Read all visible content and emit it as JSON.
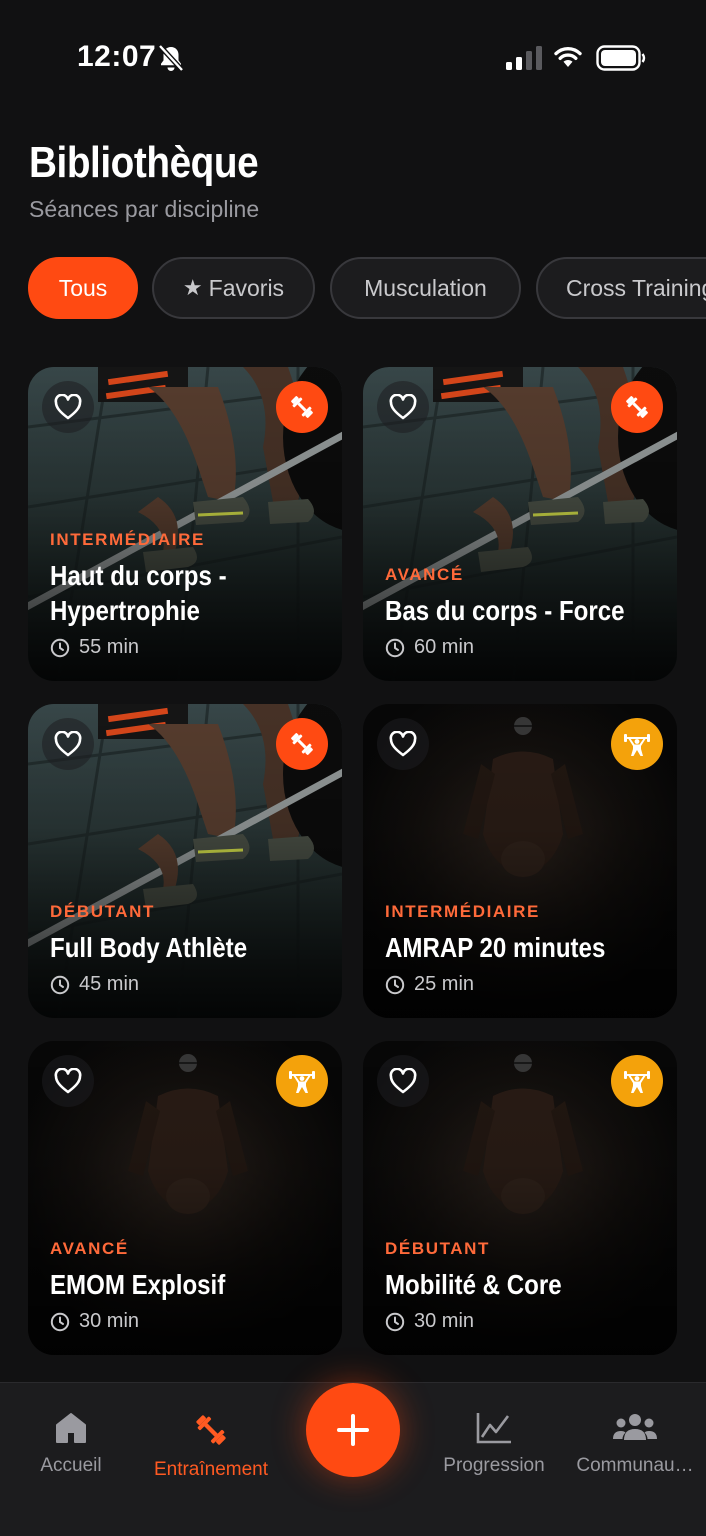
{
  "status_bar": {
    "time": "12:07"
  },
  "header": {
    "title": "Bibliothèque",
    "subtitle": "Séances par discipline"
  },
  "filters": [
    {
      "label": "Tous",
      "active": true
    },
    {
      "label": "Favoris",
      "icon": "star-icon",
      "active": false
    },
    {
      "label": "Musculation",
      "active": false
    },
    {
      "label": "Cross Training",
      "active": false
    }
  ],
  "workouts": [
    {
      "level": "INTERMÉDIAIRE",
      "title": "Haut du corps - Hypertrophie",
      "duration": "55 min",
      "discipline_icon": "dumbbell-icon",
      "badge_color": "#ff4a12"
    },
    {
      "level": "AVANCÉ",
      "title": "Bas du corps - Force",
      "duration": "60 min",
      "discipline_icon": "dumbbell-icon",
      "badge_color": "#ff4a12"
    },
    {
      "level": "DÉBUTANT",
      "title": "Full Body Athlète",
      "duration": "45 min",
      "discipline_icon": "dumbbell-icon",
      "badge_color": "#ff4a12"
    },
    {
      "level": "INTERMÉDIAIRE",
      "title": "AMRAP 20 minutes",
      "duration": "25 min",
      "discipline_icon": "weightlifter-icon",
      "badge_color": "#f4a20b"
    },
    {
      "level": "AVANCÉ",
      "title": "EMOM Explosif",
      "duration": "30 min",
      "discipline_icon": "weightlifter-icon",
      "badge_color": "#f4a20b"
    },
    {
      "level": "DÉBUTANT",
      "title": "Mobilité & Core",
      "duration": "30 min",
      "discipline_icon": "weightlifter-icon",
      "badge_color": "#f4a20b"
    }
  ],
  "nav": {
    "items": [
      {
        "label": "Accueil",
        "icon": "home-icon",
        "active": false
      },
      {
        "label": "Entraînement",
        "icon": "dumbbell-icon",
        "active": true
      },
      {
        "label": "Progression",
        "icon": "chart-icon",
        "active": false
      },
      {
        "label": "Communau…",
        "icon": "community-icon",
        "active": false
      }
    ],
    "fab_icon": "plus-icon"
  },
  "colors": {
    "accent": "#ff4a12",
    "yellow_badge": "#f4a20b",
    "background": "#111112"
  }
}
